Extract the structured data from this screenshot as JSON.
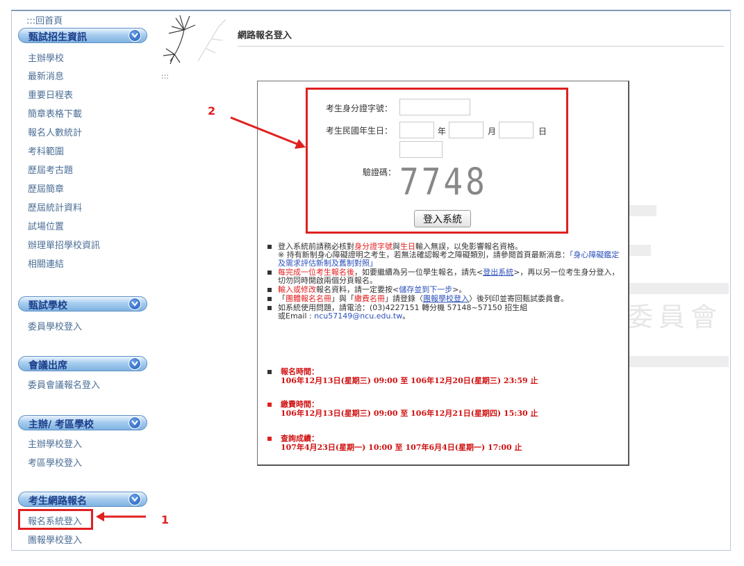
{
  "sidebar": {
    "home": ":::回首頁",
    "sections": [
      {
        "title": "甄試招生資訊",
        "items": [
          "主辦學校",
          "最新消息",
          "重要日程表",
          "簡章表格下載",
          "報名人數統計",
          "考科範圍",
          "歷屆考古題",
          "歷屆簡章",
          "歷屆統計資料",
          "試場位置",
          "辦理單招學校資訊",
          "相關連結"
        ]
      },
      {
        "title": "甄試學校",
        "items": [
          "委員學校登入"
        ]
      },
      {
        "title": "會議出席",
        "items": [
          "委員會議報名登入"
        ]
      },
      {
        "title": "主辦/ 考區學校",
        "items": [
          "主辦學校登入",
          "考區學校登入"
        ]
      },
      {
        "title": "考生網路報名",
        "items": [
          "報名系統登入",
          "團報學校登入"
        ]
      }
    ]
  },
  "header": {
    "title": "網路報名登入",
    "dots": ":::"
  },
  "watermark": "委員會",
  "form": {
    "id_label": "考生身分證字號：",
    "birth_label": "考生民國年生日：",
    "year_unit": "年",
    "month_unit": "月",
    "day_unit": "日",
    "captcha_label": "驗證碼：",
    "captcha_text": "7748",
    "login_button": "登入系統"
  },
  "notes": {
    "n1_a": "登入系統前請務必核對",
    "n1_b": "身分證字號",
    "n1_c": "與",
    "n1_d": "生日",
    "n1_e": "輸入無誤，以免影響報名資格。",
    "n1_f": "※ 持有新制身心障礙證明之考生，若無法確認報考之障礙類別，請參閱首頁最新消息：",
    "n1_g": "「身心障礙鑑定及需求評估新制及舊制對照」",
    "n2_a": "每完成一位考生報名後",
    "n2_b": "，如要繼續為另一位學生報名，請先<",
    "n2_c": "登出系統",
    "n2_d": ">，再以另一位考生身分登入，切勿同時開啟兩個分頁報名。",
    "n3_a": "輸入或修改",
    "n3_b": "報名資料，請一定要按<",
    "n3_c": "儲存並到下一步",
    "n3_d": ">。",
    "n4_a": "「",
    "n4_b": "團體報名名冊",
    "n4_c": "」與「",
    "n4_d": "繳費名冊",
    "n4_e": "」請登錄〈",
    "n4_f": "團報學校登入",
    "n4_g": "〉後列印並寄回甄試委員會。",
    "n5_a": "如系統使用問題，請電洽：(03)4227151 轉分機 57148~57150 招生組",
    "n5_b": "或Email : ",
    "n5_c": "ncu57149@ncu.edu.tw",
    "n5_d": "。"
  },
  "times": [
    {
      "label": "報名時間：",
      "value": "106年12月13日(星期三) 09:00 至 106年12月20日(星期三) 23:59 止"
    },
    {
      "label": "繳費時間：",
      "value": "106年12月13日(星期三) 09:00 至 106年12月21日(星期四) 15:30 止"
    },
    {
      "label": "查詢成績：",
      "value": "107年4月23日(星期一) 10:00 至 107年6月4日(星期一) 17:00 止"
    }
  ],
  "annotations": {
    "one": "1",
    "two": "2"
  },
  "colors": {
    "highlight": "#e02020",
    "link": "#4b6e96",
    "pill": "#7fb2e1"
  }
}
